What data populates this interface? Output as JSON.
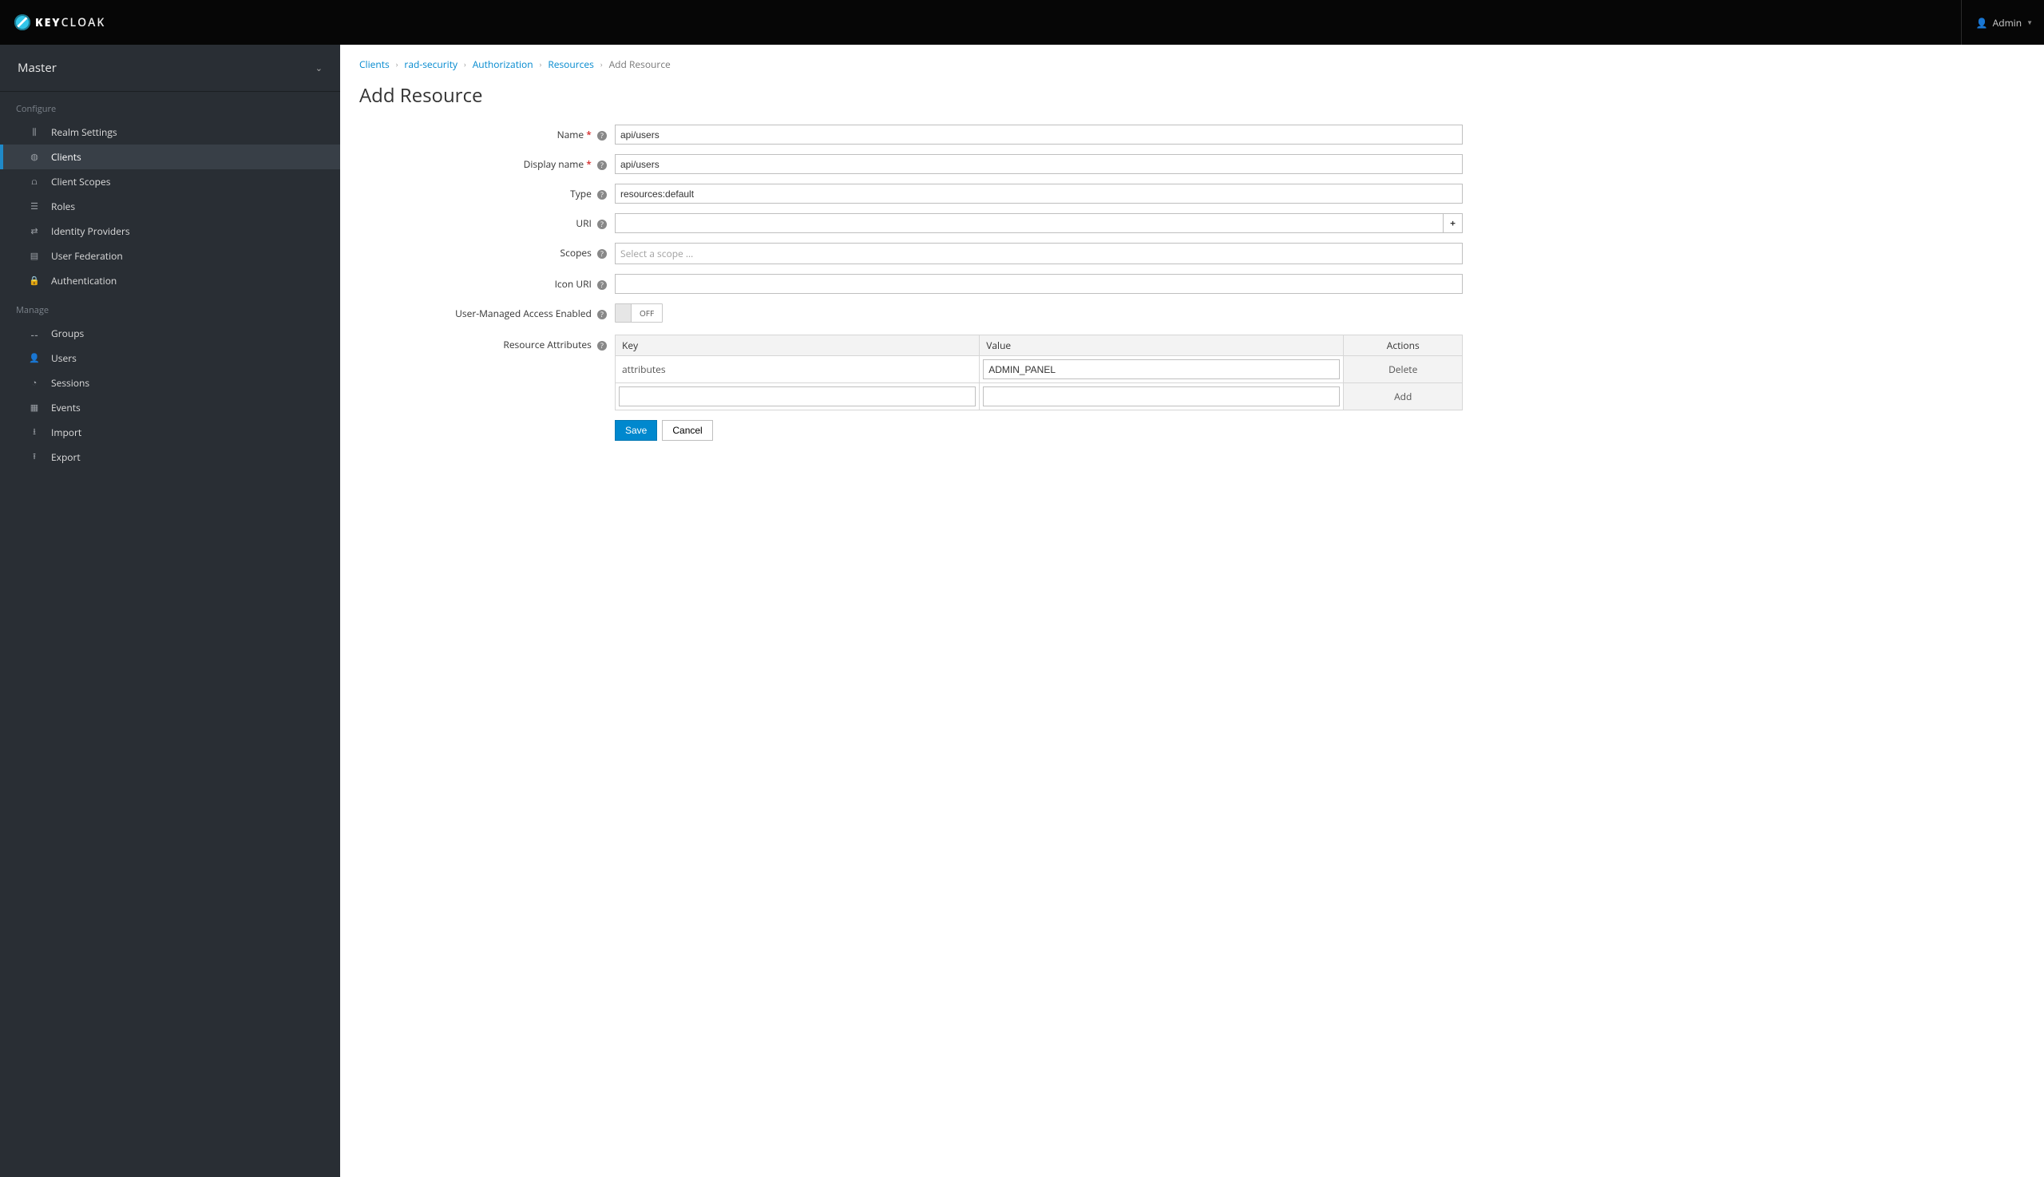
{
  "header": {
    "brand_a": "KEY",
    "brand_b": "CLOAK",
    "user_label": "Admin"
  },
  "sidebar": {
    "realm": "Master",
    "sections": {
      "configure": "Configure",
      "manage": "Manage"
    },
    "configure_items": [
      {
        "icon": "sliders-icon",
        "glyph": "⫼",
        "label": "Realm Settings"
      },
      {
        "icon": "globe-icon",
        "glyph": "◍",
        "label": "Clients",
        "active": true
      },
      {
        "icon": "scope-icon",
        "glyph": "⩍",
        "label": "Client Scopes"
      },
      {
        "icon": "list-icon",
        "glyph": "☰",
        "label": "Roles"
      },
      {
        "icon": "exchange-icon",
        "glyph": "⇄",
        "label": "Identity Providers"
      },
      {
        "icon": "database-icon",
        "glyph": "▤",
        "label": "User Federation"
      },
      {
        "icon": "lock-icon",
        "glyph": "🔒",
        "label": "Authentication"
      }
    ],
    "manage_items": [
      {
        "icon": "group-icon",
        "glyph": "⚋",
        "label": "Groups"
      },
      {
        "icon": "user-icon",
        "glyph": "👤",
        "label": "Users"
      },
      {
        "icon": "clock-icon",
        "glyph": "◔",
        "label": "Sessions"
      },
      {
        "icon": "calendar-icon",
        "glyph": "▦",
        "label": "Events"
      },
      {
        "icon": "import-icon",
        "glyph": "⭳",
        "label": "Import"
      },
      {
        "icon": "export-icon",
        "glyph": "⭱",
        "label": "Export"
      }
    ]
  },
  "breadcrumb": [
    {
      "label": "Clients",
      "link": true
    },
    {
      "label": "rad-security",
      "link": true
    },
    {
      "label": "Authorization",
      "link": true
    },
    {
      "label": "Resources",
      "link": true
    },
    {
      "label": "Add Resource",
      "link": false
    }
  ],
  "page": {
    "title": "Add Resource"
  },
  "form": {
    "labels": {
      "name": "Name",
      "display_name": "Display name",
      "type": "Type",
      "uri": "URI",
      "scopes": "Scopes",
      "icon_uri": "Icon URI",
      "uma": "User-Managed Access Enabled",
      "attrs": "Resource Attributes"
    },
    "values": {
      "name": "api/users",
      "display_name": "api/users",
      "type": "resources:default",
      "uri": "",
      "scopes_placeholder": "Select a scope …",
      "icon_uri": "",
      "uma_state": "OFF"
    },
    "attr_table": {
      "headers": {
        "key": "Key",
        "value": "Value",
        "actions": "Actions"
      },
      "rows": [
        {
          "key": "attributes",
          "value": "ADMIN_PANEL",
          "action": "Delete",
          "key_editable": false
        },
        {
          "key": "",
          "value": "",
          "action": "Add",
          "key_editable": true
        }
      ]
    },
    "buttons": {
      "save": "Save",
      "cancel": "Cancel"
    }
  }
}
